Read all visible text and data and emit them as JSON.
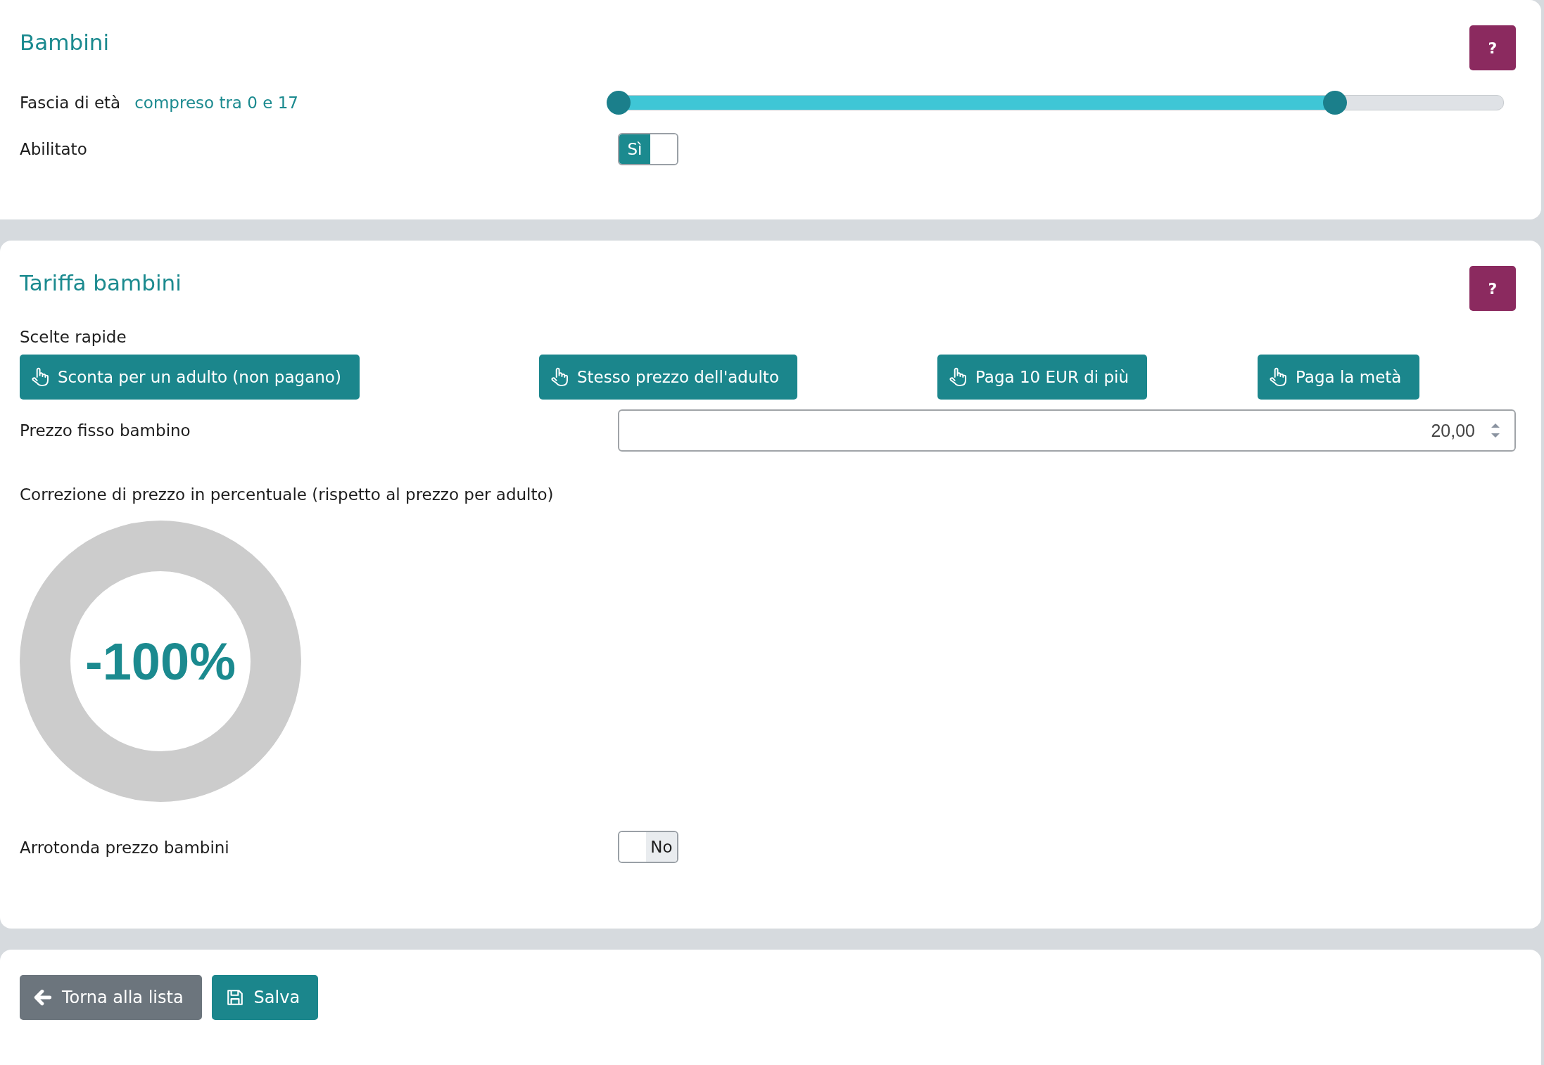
{
  "age_section": {
    "title": "Bambini",
    "help": "?",
    "age_range": {
      "label": "Fascia di età",
      "summary": "compreso tra 0 e 17",
      "handles": [
        {
          "level": 0
        },
        {
          "level": 0.81
        }
      ]
    },
    "enabled": {
      "label": "Abilitato",
      "on": true,
      "text": "Sì"
    }
  },
  "rate_section": {
    "title": "Tariffa bambini",
    "help": "?",
    "quick_label": "Scelte rapide",
    "quick_choices": [
      "Sconta per un adulto (non pagano)",
      "Stesso prezzo dell'adulto",
      "Paga 10 EUR di più",
      "Paga la metà"
    ],
    "fixed_price": {
      "label": "Prezzo fisso bambino",
      "value": "20,00"
    },
    "correction": {
      "label": "Correzione di prezzo in percentuale (rispetto al prezzo per adulto)",
      "value": "-100%"
    },
    "rounding": {
      "label": "Arrotonda prezzo bambini",
      "on": false,
      "text": "No"
    }
  },
  "actions": [
    {
      "kind": "back",
      "label": "Torna alla lista"
    },
    {
      "kind": "save",
      "label": "Salva"
    }
  ]
}
